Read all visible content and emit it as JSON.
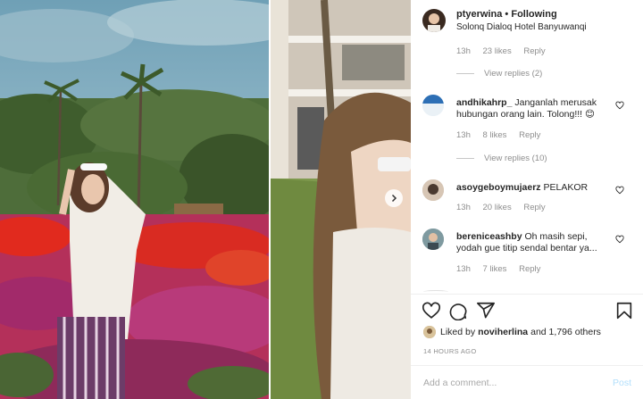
{
  "post": {
    "username": "ptyerwina",
    "separator": "•",
    "follow_status": "Following",
    "location": "Solonq Dialoq Hotel Banyuwanqi"
  },
  "thread": {
    "prev_meta": {
      "time": "13h",
      "likes": "23 likes",
      "reply": "Reply"
    },
    "prev_view_replies": "View replies (2)",
    "comments": [
      {
        "user": "andhikahrp_",
        "text": "Janganlah merusak hubungan orang lain. Tolong!!!",
        "emoji": "😊",
        "time": "13h",
        "likes": "8 likes",
        "reply": "Reply",
        "view_replies": "View replies (10)"
      },
      {
        "user": "asoygeboymujaerz",
        "text": "PELAKOR",
        "time": "13h",
        "likes": "20 likes",
        "reply": "Reply"
      },
      {
        "user": "bereniceashby",
        "text": "Oh masih sepi, yodah gue titip sendal bentar ya...",
        "time": "13h",
        "likes": "7 likes",
        "reply": "Reply"
      }
    ]
  },
  "likes": {
    "prefix": "Liked by",
    "user": "noviherlina",
    "rest": "and 1,796 others"
  },
  "time_ago": "14 HOURS AGO",
  "composer": {
    "placeholder": "Add a comment...",
    "post_label": "Post"
  },
  "icons": [
    "heart-icon",
    "comment-icon",
    "share-icon",
    "bookmark-icon",
    "chevron-right-icon"
  ],
  "colors": {
    "link_blue_disabled": "#b2dffc",
    "meta_gray": "#8e8e8e",
    "text": "#262626"
  }
}
